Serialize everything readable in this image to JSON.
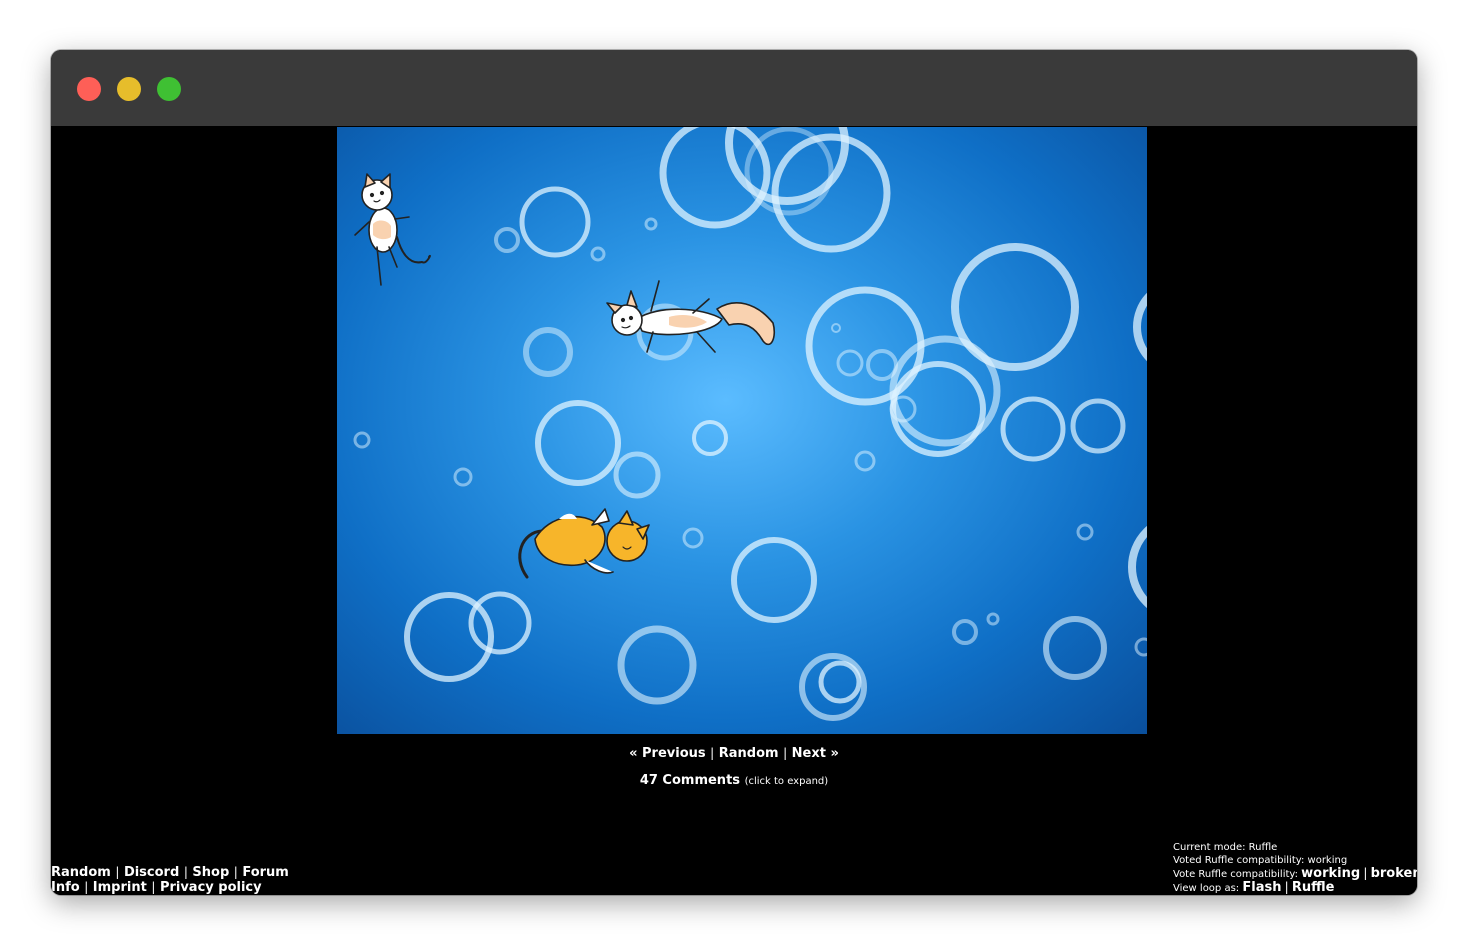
{
  "nav": {
    "previous": "« Previous",
    "random": "Random",
    "next": "Next »",
    "separator": "|"
  },
  "comments": {
    "count_label": "47 Comments",
    "hint": "(click to expand)"
  },
  "footer_links": {
    "random": "Random",
    "discord": "Discord",
    "shop": "Shop",
    "forum": "Forum",
    "info": "Info",
    "imprint": "Imprint",
    "privacy": "Privacy policy"
  },
  "status": {
    "current_mode_label": "Current mode:",
    "current_mode_value": "Ruffle",
    "voted_label": "Voted Ruffle compatibility:",
    "voted_value": "working",
    "vote_label": "Vote Ruffle compatibility:",
    "vote_working": "working",
    "vote_broken": "broken",
    "view_label": "View loop as:",
    "view_flash": "Flash",
    "view_ruffle": "Ruffle"
  },
  "colors": {
    "background": "#000000",
    "bubble": "#d8f0ff",
    "orange_cat": "#f7b52a",
    "cream_cat": "#f9d2b0"
  },
  "icons": {
    "close": "traffic-light-red",
    "minimize": "traffic-light-yellow",
    "maximize": "traffic-light-green"
  }
}
